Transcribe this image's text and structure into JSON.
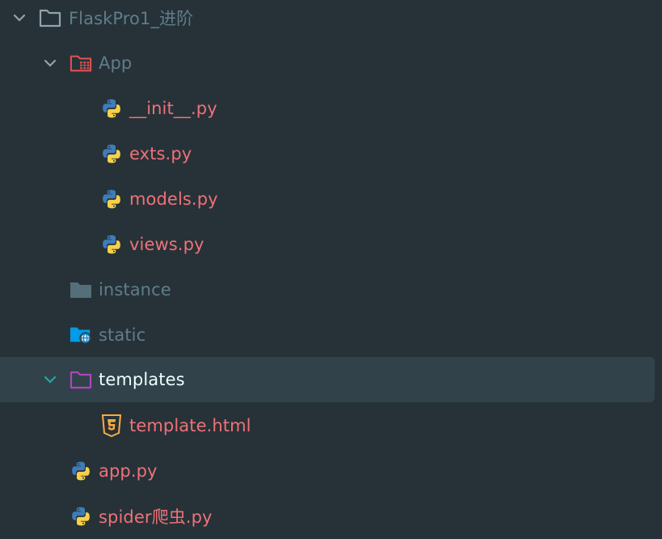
{
  "colors": {
    "background": "#263238",
    "selected_row": "#32424a",
    "folder_text": "#607d8b",
    "file_text": "#f07178",
    "selected_text": "#eeffff",
    "chevron": "#90a4ae",
    "chevron_active": "#26a69a"
  },
  "tree": {
    "root": {
      "label": "FlaskPro1_进阶",
      "icon": "folder-outline-icon",
      "expanded": true
    },
    "app_folder": {
      "label": "App",
      "icon": "app-folder-icon",
      "expanded": true
    },
    "init_file": {
      "label": "__init__.py",
      "icon": "python-icon"
    },
    "exts_file": {
      "label": "exts.py",
      "icon": "python-icon"
    },
    "models_file": {
      "label": "models.py",
      "icon": "python-icon"
    },
    "views_file": {
      "label": "views.py",
      "icon": "python-icon"
    },
    "instance_folder": {
      "label": "instance",
      "icon": "folder-icon"
    },
    "static_folder": {
      "label": "static",
      "icon": "static-folder-icon"
    },
    "templates_folder": {
      "label": "templates",
      "icon": "templates-folder-icon",
      "expanded": true,
      "selected": true
    },
    "template_file": {
      "label": "template.html",
      "icon": "html5-icon"
    },
    "app_file": {
      "label": "app.py",
      "icon": "python-icon"
    },
    "spider_file": {
      "label": "spider爬虫.py",
      "icon": "python-icon"
    }
  }
}
